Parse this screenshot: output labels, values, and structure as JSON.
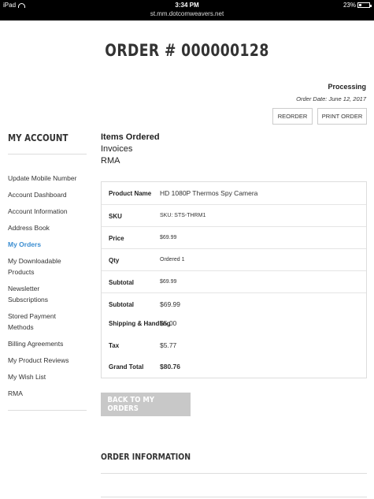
{
  "status_bar": {
    "device": "iPad",
    "time": "3:34 PM",
    "url": "st.mm.dotcomweavers.net",
    "battery": "23%",
    "battery_level": 0.23
  },
  "page": {
    "title": "ORDER # 000000128",
    "status": "Processing",
    "order_date_label": "Order Date:",
    "order_date_value": "June 12, 2017",
    "reorder_label": "REORDER",
    "print_label": "PRINT ORDER"
  },
  "sidebar": {
    "title": "MY ACCOUNT",
    "items": [
      {
        "label": "Update Mobile Number"
      },
      {
        "label": "Account Dashboard"
      },
      {
        "label": "Account Information"
      },
      {
        "label": "Address Book"
      },
      {
        "label": "My Orders"
      },
      {
        "label": "My Downloadable Products"
      },
      {
        "label": "Newsletter Subscriptions"
      },
      {
        "label": "Stored Payment Methods"
      },
      {
        "label": "Billing Agreements"
      },
      {
        "label": "My Product Reviews"
      },
      {
        "label": "My Wish List"
      },
      {
        "label": "RMA"
      }
    ]
  },
  "tabs": {
    "items_ordered": "Items Ordered",
    "invoices": "Invoices",
    "rma": "RMA"
  },
  "order_table": {
    "product_name_label": "Product Name",
    "product_name_value": "HD 1080P Thermos Spy Camera",
    "sku_label": "SKU",
    "sku_value": "SKU: STS-THRM1",
    "price_label": "Price",
    "price_value": "$69.99",
    "qty_label": "Qty",
    "qty_value": "Ordered 1",
    "row_subtotal_label": "Subtotal",
    "row_subtotal_value": "$69.99",
    "subtotal_label": "Subtotal",
    "subtotal_value": "$69.99",
    "shipping_label": "Shipping & Handling",
    "shipping_value": "$5.00",
    "tax_label": "Tax",
    "tax_value": "$5.77",
    "grand_total_label": "Grand Total",
    "grand_total_value": "$80.76"
  },
  "back_button_label": "BACK TO MY ORDERS",
  "order_information_title": "ORDER INFORMATION",
  "colors": {
    "accent": "#3a8dd1",
    "back_button": "#c8c8c8",
    "status_bar": "#000000"
  }
}
